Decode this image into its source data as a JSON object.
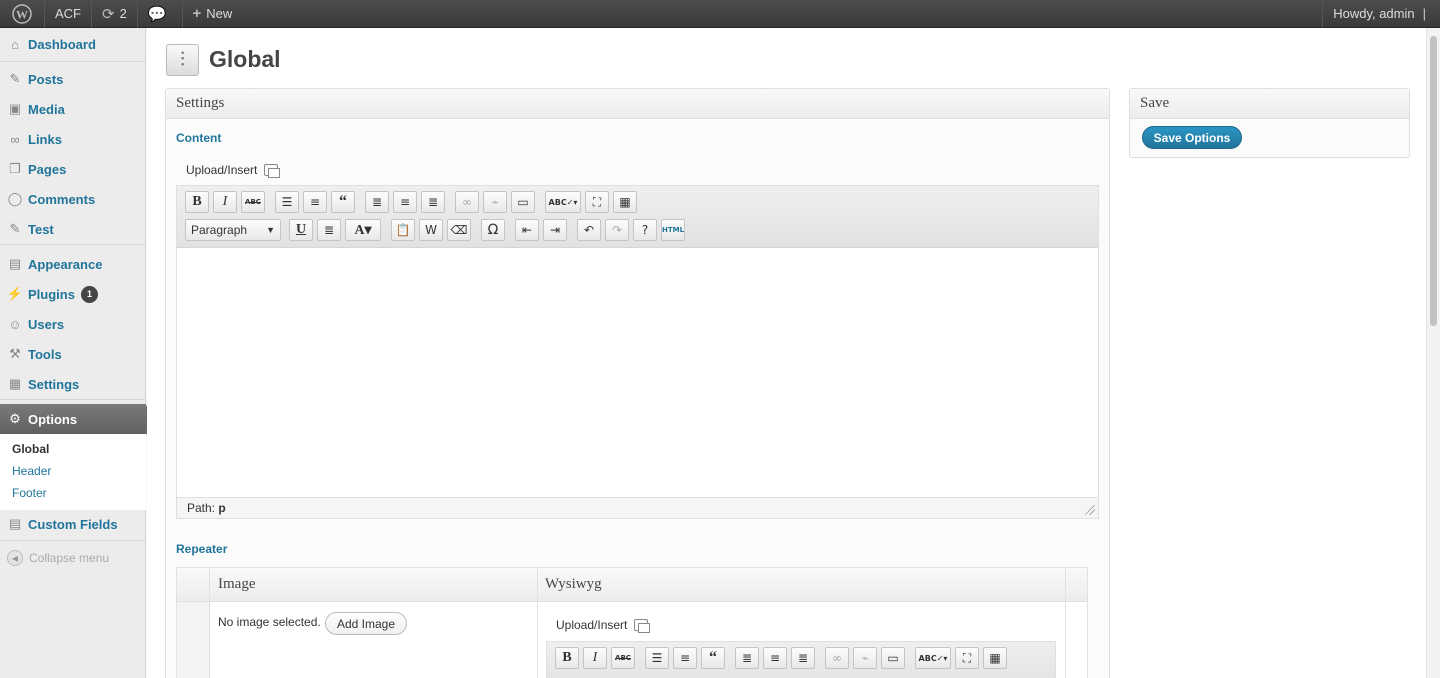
{
  "adminbar": {
    "site_name": "ACF",
    "updates_count": "2",
    "new_label": "New",
    "howdy": "Howdy, admin"
  },
  "sidebar": {
    "items": [
      {
        "label": "Dashboard",
        "icon": "dashboard-icon"
      },
      {
        "label": "Posts",
        "icon": "pin-icon"
      },
      {
        "label": "Media",
        "icon": "media-icon"
      },
      {
        "label": "Links",
        "icon": "link-icon"
      },
      {
        "label": "Pages",
        "icon": "pages-icon"
      },
      {
        "label": "Comments",
        "icon": "comment-icon"
      },
      {
        "label": "Test",
        "icon": "pin-icon"
      },
      {
        "label": "Appearance",
        "icon": "appearance-icon"
      },
      {
        "label": "Plugins",
        "icon": "plug-icon",
        "badge": "1"
      },
      {
        "label": "Users",
        "icon": "users-icon"
      },
      {
        "label": "Tools",
        "icon": "tools-icon"
      },
      {
        "label": "Settings",
        "icon": "settings-icon"
      },
      {
        "label": "Options",
        "icon": "gear-icon"
      },
      {
        "label": "Custom Fields",
        "icon": "fields-icon"
      }
    ],
    "submenu": [
      "Global",
      "Header",
      "Footer"
    ],
    "collapse": "Collapse menu"
  },
  "page": {
    "title": "Global"
  },
  "settings_box": {
    "title": "Settings",
    "content_label": "Content",
    "upload_insert": "Upload/Insert",
    "format_select": "Paragraph",
    "path_label": "Path:",
    "path_value": "p",
    "repeater_label": "Repeater",
    "repeater_columns": [
      "Image",
      "Wysiwyg"
    ],
    "no_image": "No image selected.",
    "add_image": "Add Image",
    "upload_insert_2": "Upload/Insert"
  },
  "save_box": {
    "title": "Save",
    "button": "Save Options"
  },
  "colors": {
    "link": "#21759b",
    "adminbar": "#464646",
    "active_menu": "#6b6b6b"
  }
}
